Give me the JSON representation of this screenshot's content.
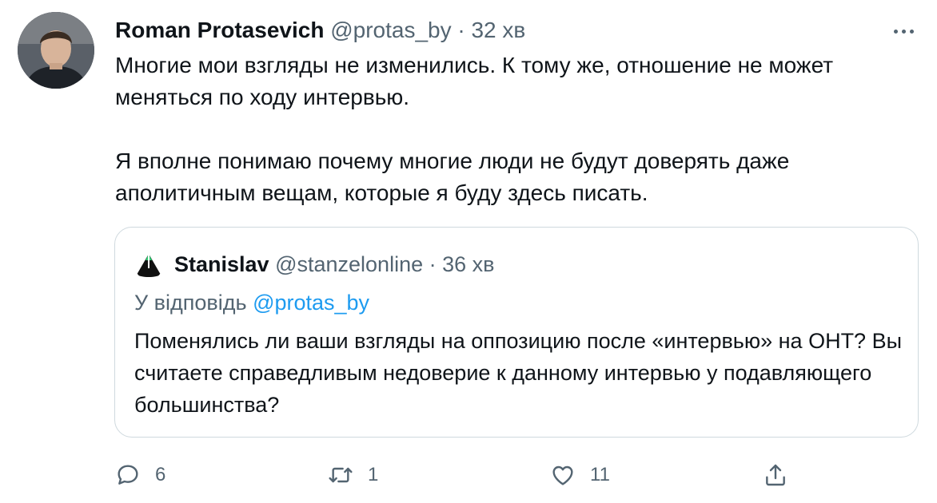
{
  "tweet": {
    "author_name": "Roman Protasevich",
    "author_handle": "@protas_by",
    "separator": "·",
    "time": "32 хв",
    "text": "Многие мои взгляды не изменились. К тому же, отношение не может меняться по ходу интервью.\n\nЯ вполне понимаю почему многие люди не будут доверять даже аполитичным вещам, которые я буду здесь писать."
  },
  "quoted": {
    "author_name": "Stanislav",
    "author_handle": "@stanzelonline",
    "separator": "·",
    "time": "36 хв",
    "reply_prefix": "У відповідь",
    "reply_to": "@protas_by",
    "text": "Поменялись ли ваши взгляды на оппозицию после «интервью» на ОНТ? Вы считаете справедливым недоверие к данному интервью у подавляющего большинства?"
  },
  "actions": {
    "reply_count": "6",
    "retweet_count": "1",
    "like_count": "11"
  },
  "icons": {
    "more": "more-icon",
    "reply": "reply-icon",
    "retweet": "retweet-icon",
    "like": "like-icon",
    "share": "share-icon"
  },
  "colors": {
    "text": "#0f1419",
    "muted": "#536471",
    "link": "#1d9bf0",
    "border": "#cfd9de"
  }
}
